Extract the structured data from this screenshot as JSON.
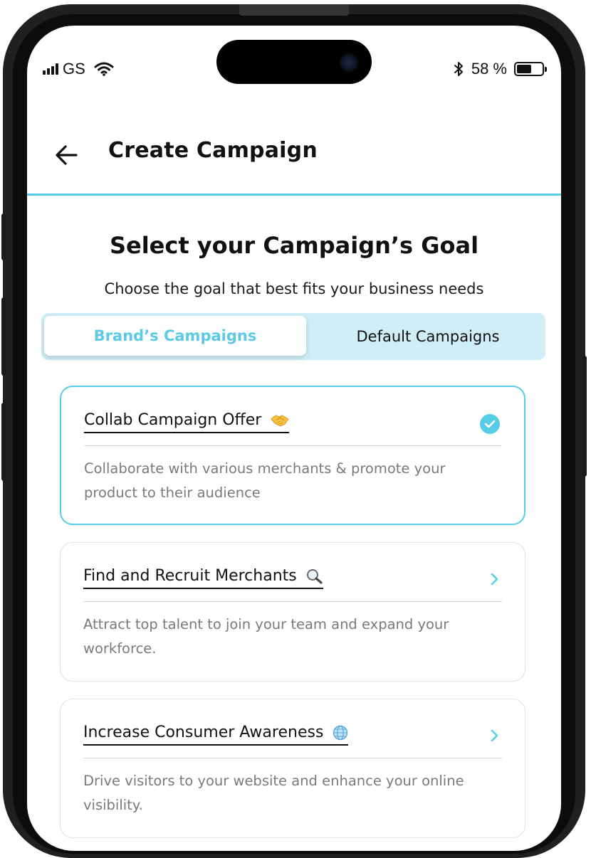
{
  "status_bar": {
    "carrier": "GS",
    "battery_percent": "58 %",
    "battery_level": 0.58,
    "icons": [
      "signal-icon",
      "wifi-icon",
      "bluetooth-icon",
      "battery-icon"
    ]
  },
  "header": {
    "title": "Create Campaign",
    "back_icon": "arrow-left-icon"
  },
  "page": {
    "title": "Select your Campaign’s Goal",
    "subtitle": "Choose the goal that best fits your business needs"
  },
  "tabs": [
    {
      "label": "Brand’s Campaigns",
      "active": true
    },
    {
      "label": "Default Campaigns",
      "active": false
    }
  ],
  "cards": [
    {
      "title": "Collab Campaign Offer",
      "emoji": "handshake-icon",
      "description": "Collaborate with various merchants & promote your product to their audience",
      "selected": true,
      "indicator": "check-circle-icon"
    },
    {
      "title": "Find and Recruit Merchants",
      "emoji": "magnifier-icon",
      "description": "Attract top talent to join your team and expand your workforce.",
      "selected": false,
      "indicator": "chevron-right-icon"
    },
    {
      "title": "Increase Consumer Awareness",
      "emoji": "globe-icon",
      "description": "Drive visitors to your website and enhance your online visibility.",
      "selected": false,
      "indicator": "chevron-right-icon"
    }
  ],
  "colors": {
    "accent": "#56cde6",
    "tab_track": "#cfeef7",
    "text": "#111111",
    "muted": "#7a7a7a"
  }
}
